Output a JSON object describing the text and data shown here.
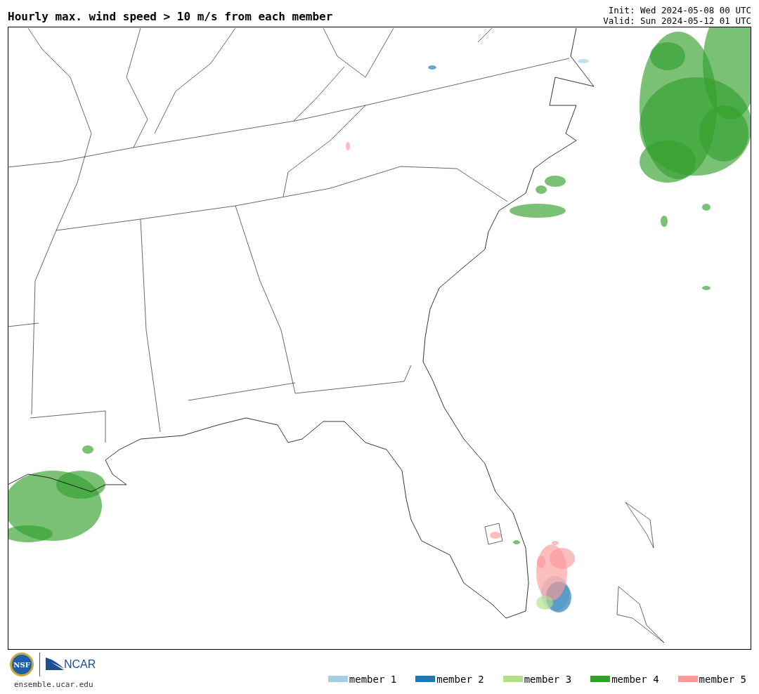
{
  "title": "Hourly max. wind speed > 10 m/s from each member",
  "init": "Init: Wed 2024-05-08 00 UTC",
  "valid": "Valid: Sun 2024-05-12 01 UTC",
  "logos": {
    "nsf": "NSF",
    "ncar": "NCAR",
    "url": "ensemble.ucar.edu"
  },
  "legend": [
    {
      "label": "member 1",
      "color": "#a6cee3"
    },
    {
      "label": "member 2",
      "color": "#1f78b4"
    },
    {
      "label": "member 3",
      "color": "#b2df8a"
    },
    {
      "label": "member 4",
      "color": "#33a02c"
    },
    {
      "label": "member 5",
      "color": "#fb9a99"
    }
  ]
}
